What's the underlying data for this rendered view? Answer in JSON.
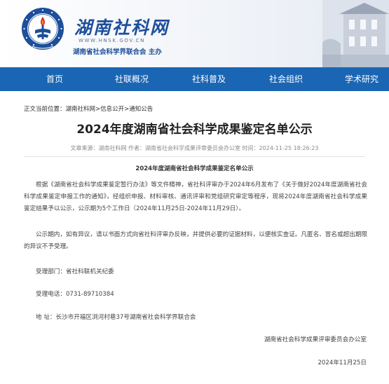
{
  "header": {
    "title": "湖南社科网",
    "url": "WWW.HNSK.GOV.CN",
    "host": "湖南省社会科学界联合会  主办",
    "seal_text": "湖南省社会科学界联合会"
  },
  "nav": {
    "items": [
      {
        "label": "首页"
      },
      {
        "label": "社联概况"
      },
      {
        "label": "社科普及"
      },
      {
        "label": "社会组织"
      },
      {
        "label": "学术研究"
      }
    ]
  },
  "breadcrumb": {
    "prefix": "正文当前位置：",
    "items": [
      "湖南社科网",
      "信息公开",
      "通知公告"
    ],
    "sep": ">"
  },
  "article": {
    "title": "2024年度湖南省社会科学成果鉴定名单公示",
    "meta": "文章来源：湖南社科网  作者：湖南省社会科学成果评审委员会办公室  时间：2024-11-25 18:26:23",
    "subtitle": "2024年度湖南省社会科学成果鉴定名单公示",
    "para1": "根据《湖南省社会科学成果鉴定暂行办法》等文件精神，省社科评审办于2024年6月发布了《关于做好2024年度湖南省社会科学成果鉴定申报工作的通知》，经组织申报、材料审核、通讯评审和党组研究审定等程序，现将2024年度湖南省社会科学成果鉴定结果予以公示，公示期为5个工作日（2024年11月25日-2024年11月29日）。",
    "para2": "公示期内，如有异议，请以书面方式向省社科评审办反映，并提供必要的证据材料，以便核实查证。凡匿名、冒名或超出期限的异议不予受理。",
    "dept": "受理部门：省社科联机关纪委",
    "phone": "受理电话：0731-89710384",
    "address": "地 址：长沙市开福区浏河村巷37号湖南省社会科学界联合会",
    "signature": "湖南省社会科学成果评审委员会办公室",
    "date": "2024年11月25日"
  },
  "colors": {
    "nav_bg": "#1b66b4",
    "brand_blue": "#1d4f9a"
  }
}
